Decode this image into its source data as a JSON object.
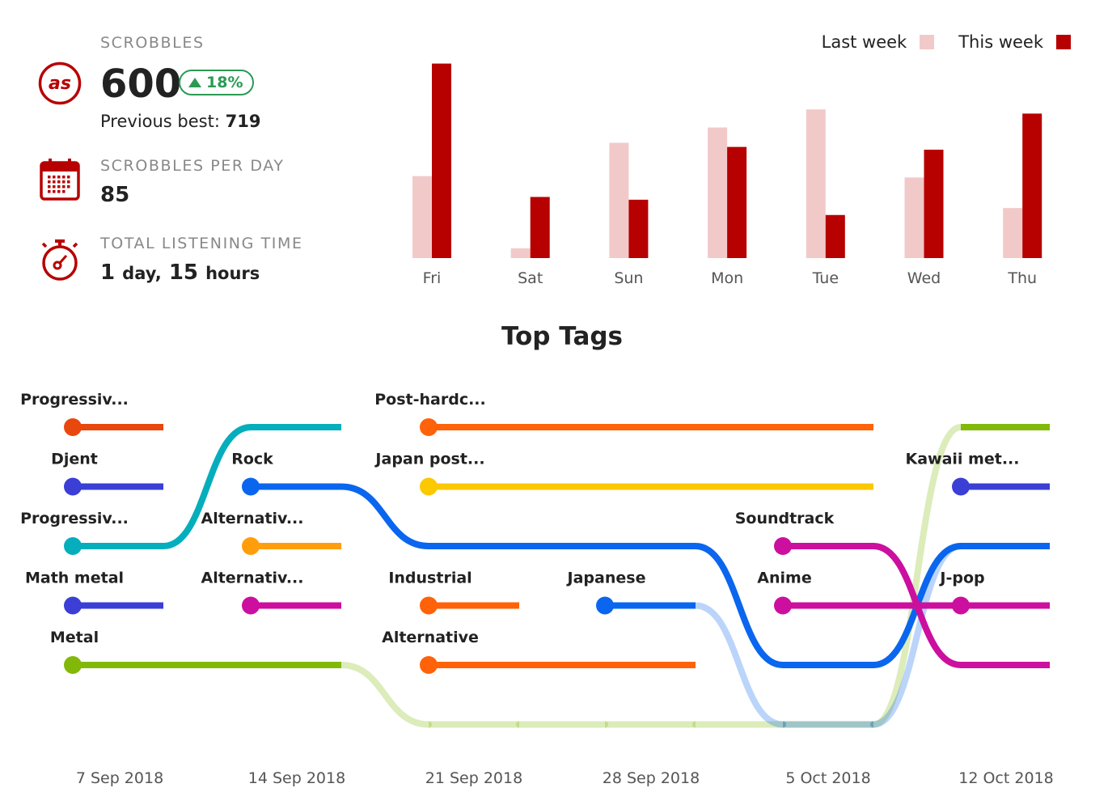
{
  "stats": {
    "scrobbles_label": "SCROBBLES",
    "scrobbles_value": "600",
    "change_value": "18%",
    "previous_best_label": "Previous best:",
    "previous_best_value": "719",
    "per_day_label": "SCROBBLES PER DAY",
    "per_day_value": "85",
    "listening_label": "TOTAL LISTENING TIME",
    "listening_days": "1",
    "listening_days_unit": "day,",
    "listening_hours": "15",
    "listening_hours_unit": "hours"
  },
  "icons": {
    "scrobbles": "lastfm-logo-icon",
    "per_day": "calendar-icon",
    "listening": "stopwatch-icon"
  },
  "colors": {
    "accent": "#b70000",
    "last_week": "#f2c9c9",
    "this_week": "#b70000",
    "positive": "#2b9a55"
  },
  "chart_data": [
    {
      "type": "bar",
      "categories": [
        "Fri",
        "Sat",
        "Sun",
        "Mon",
        "Tue",
        "Wed",
        "Thu"
      ],
      "series": [
        {
          "name": "Last week",
          "color": "#f2c9c9",
          "values": [
            59,
            7,
            83,
            94,
            107,
            58,
            36
          ]
        },
        {
          "name": "This week",
          "color": "#b70000",
          "values": [
            140,
            44,
            42,
            80,
            31,
            78,
            104
          ]
        }
      ],
      "legend": "top-right",
      "ylim": [
        0,
        145
      ],
      "grid": false
    },
    {
      "type": "line",
      "title": "Top Tags",
      "x": [
        "7 Sep 2018",
        "14 Sep 2018",
        "21 Sep 2018",
        "28 Sep 2018",
        "5 Oct 2018",
        "12 Oct 2018"
      ],
      "ranks": [
        "1",
        "2",
        "3",
        "4",
        "5",
        "6"
      ],
      "series": [
        {
          "name": "Progressiv...",
          "color": "#e8470e",
          "ranks": [
            1,
            null,
            null,
            null,
            null,
            null
          ]
        },
        {
          "name": "Djent",
          "color": "#3b3fd6",
          "ranks": [
            2,
            null,
            null,
            null,
            null,
            null
          ]
        },
        {
          "name": "Progressiv...",
          "color": "#05aebc",
          "ranks": [
            3,
            1,
            null,
            null,
            null,
            null
          ]
        },
        {
          "name": "Math metal",
          "color": "#3b3fd6",
          "ranks": [
            4,
            null,
            null,
            null,
            null,
            null
          ]
        },
        {
          "name": "Metal",
          "color": "#82b908",
          "ranks": [
            5,
            5,
            6,
            6,
            6,
            1
          ]
        },
        {
          "name": "Rock",
          "color": "#0a66ee",
          "ranks": [
            null,
            2,
            3,
            3,
            5,
            3
          ]
        },
        {
          "name": "Alternativ...",
          "color": "#ff9e0a",
          "ranks": [
            null,
            3,
            null,
            null,
            null,
            null
          ]
        },
        {
          "name": "Alternativ...",
          "color": "#cc0f9f",
          "ranks": [
            null,
            4,
            null,
            null,
            null,
            null
          ]
        },
        {
          "name": "Post-hardc...",
          "color": "#ff6208",
          "ranks": [
            null,
            null,
            1,
            1,
            1,
            null
          ]
        },
        {
          "name": "Japan post...",
          "color": "#fcc800",
          "ranks": [
            null,
            null,
            2,
            2,
            2,
            null
          ]
        },
        {
          "name": "Industrial",
          "color": "#ff6208",
          "ranks": [
            null,
            null,
            4,
            null,
            null,
            null
          ]
        },
        {
          "name": "Alternative",
          "color": "#ff6208",
          "ranks": [
            null,
            null,
            5,
            5,
            null,
            null
          ]
        },
        {
          "name": "Japanese",
          "color": "#0a66ee",
          "ranks": [
            null,
            null,
            null,
            4,
            6,
            3
          ]
        },
        {
          "name": "Soundtrack",
          "color": "#cc0f9f",
          "ranks": [
            null,
            null,
            null,
            null,
            3,
            5
          ]
        },
        {
          "name": "Anime",
          "color": "#cc0f9f",
          "ranks": [
            null,
            null,
            null,
            null,
            4,
            4
          ]
        },
        {
          "name": "Kawaii met...",
          "color": "#3b3fd6",
          "ranks": [
            null,
            null,
            null,
            null,
            null,
            2
          ]
        },
        {
          "name": "J-pop",
          "color": "#cc0f9f",
          "ranks": [
            null,
            null,
            null,
            null,
            null,
            4
          ]
        }
      ]
    }
  ]
}
